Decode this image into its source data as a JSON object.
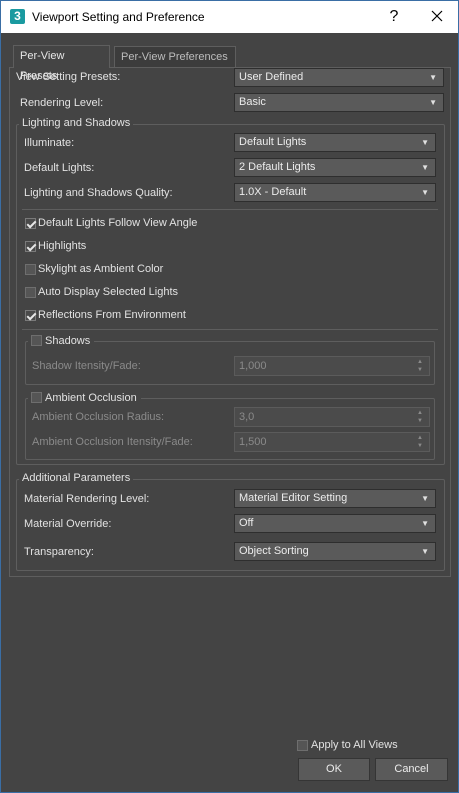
{
  "window": {
    "title": "Viewport Setting and Preference",
    "app_icon_text": "3",
    "help_glyph": "?"
  },
  "tabs": [
    {
      "label": "Per-View Presets",
      "active": true
    },
    {
      "label": "Per-View Preferences",
      "active": false
    }
  ],
  "presets": {
    "view_setting_presets": {
      "label": "View Setting Presets:",
      "value": "User Defined"
    },
    "rendering_level": {
      "label": "Rendering Level:",
      "value": "Basic"
    }
  },
  "lighting": {
    "group_title": "Lighting and Shadows",
    "illuminate": {
      "label": "Illuminate:",
      "value": "Default Lights"
    },
    "default_lights": {
      "label": "Default Lights:",
      "value": "2 Default Lights"
    },
    "quality": {
      "label": "Lighting and Shadows Quality:",
      "value": "1.0X - Default"
    },
    "checkboxes": [
      {
        "label": "Default Lights Follow View Angle",
        "checked": true
      },
      {
        "label": "Highlights",
        "checked": true
      },
      {
        "label": "Skylight as Ambient Color",
        "checked": false
      },
      {
        "label": "Auto Display Selected Lights",
        "checked": false
      },
      {
        "label": "Reflections From Environment",
        "checked": true
      }
    ],
    "shadows": {
      "title": "Shadows",
      "checked": false,
      "intensity": {
        "label": "Shadow Itensity/Fade:",
        "value": "1,000"
      }
    },
    "ambient_occlusion": {
      "title": "Ambient Occlusion",
      "checked": false,
      "radius": {
        "label": "Ambient Occlusion Radius:",
        "value": "3,0"
      },
      "intensity": {
        "label": "Ambient Occlusion Itensity/Fade:",
        "value": "1,500"
      }
    }
  },
  "additional": {
    "group_title": "Additional Parameters",
    "material_rendering_level": {
      "label": "Material Rendering Level:",
      "value": "Material Editor Setting"
    },
    "material_override": {
      "label": "Material Override:",
      "value": "Off"
    },
    "transparency": {
      "label": "Transparency:",
      "value": "Object Sorting"
    }
  },
  "footer": {
    "apply_all": {
      "label": "Apply to All Views",
      "checked": false
    },
    "ok_label": "OK",
    "cancel_label": "Cancel"
  },
  "colors": {
    "background": "#444444",
    "dropdown": "#5a5a5a",
    "titlebar": "#ffffff",
    "app_icon": "#1a9aa0"
  }
}
